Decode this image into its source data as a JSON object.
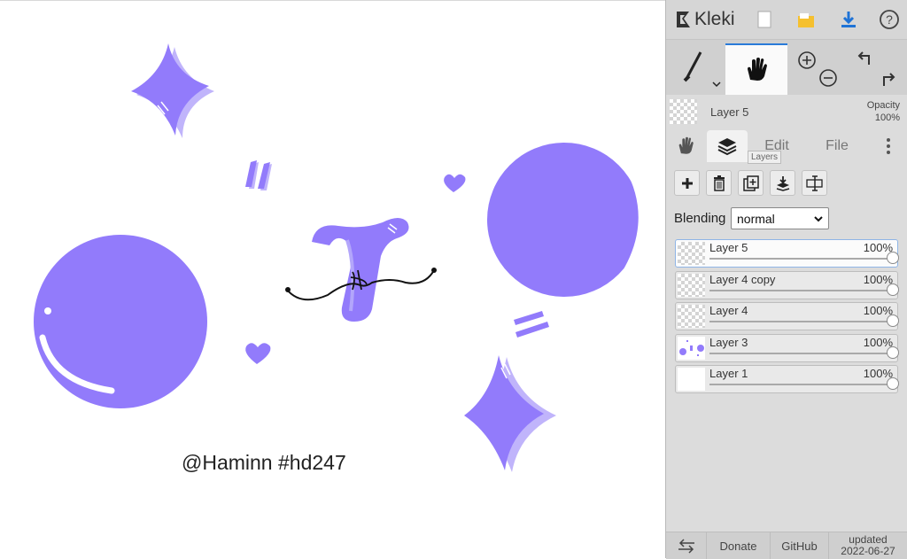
{
  "app": {
    "name": "Kleki"
  },
  "canvas": {
    "watermark": "@Haminn #hd247",
    "art_color": "#927bfb",
    "shadow_color": "#c0b4fb"
  },
  "topbar": {
    "icons": [
      "new-file-icon",
      "save-icon",
      "download-icon",
      "help-icon"
    ]
  },
  "layer_info": {
    "name": "Layer 5",
    "opacity_label": "Opacity",
    "opacity_value": "100%"
  },
  "tabs": {
    "edit": "Edit",
    "file": "File",
    "tooltip": "Layers"
  },
  "blending": {
    "label": "Blending",
    "value": "normal",
    "options": [
      "normal"
    ]
  },
  "layers": [
    {
      "name": "Layer 5",
      "opacity": "100%",
      "opacity_value": 1.0,
      "active": true
    },
    {
      "name": "Layer 4 copy",
      "opacity": "100%",
      "opacity_value": 1.0,
      "active": false
    },
    {
      "name": "Layer 4",
      "opacity": "100%",
      "opacity_value": 1.0,
      "active": false
    },
    {
      "name": "Layer 3",
      "opacity": "100%",
      "opacity_value": 1.0,
      "active": false
    },
    {
      "name": "Layer 1",
      "opacity": "100%",
      "opacity_value": 1.0,
      "active": false
    }
  ],
  "footer": {
    "donate": "Donate",
    "github": "GitHub",
    "updated_label": "updated",
    "updated_date": "2022-06-27"
  }
}
